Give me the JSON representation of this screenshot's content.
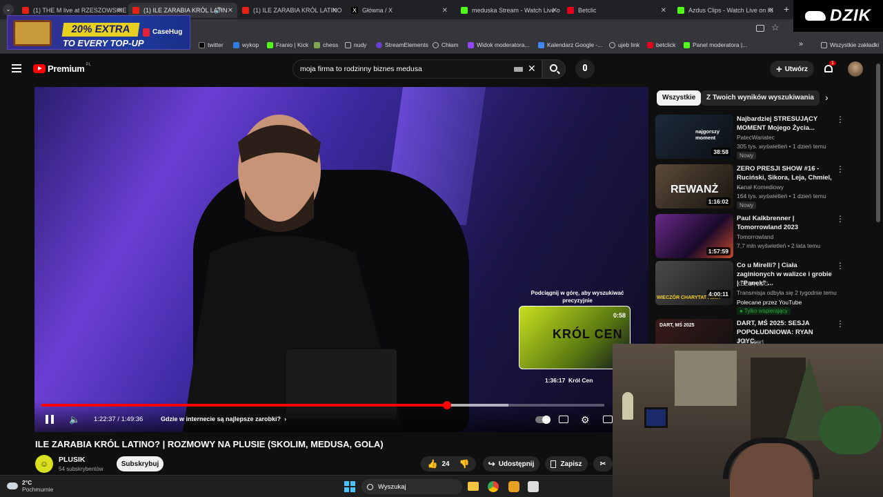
{
  "browser": {
    "tabs": [
      {
        "label": "(1) THE M live at RZESZOWSKIE",
        "color": "#e62117"
      },
      {
        "label": "(1) ILE ZARABIA KRÓL LATIN",
        "color": "#e62117"
      },
      {
        "label": "(1) ILE ZARABIA KRÓL LATINO",
        "color": "#e62117"
      },
      {
        "label": "Główna / X",
        "color": "#ffffff"
      },
      {
        "label": "meduska Stream - Watch Live o",
        "color": "#53fc18"
      },
      {
        "label": "Betclic",
        "color": "#e2001a"
      },
      {
        "label": "Azdus Clips - Watch Live on Ki",
        "color": "#53fc18"
      }
    ],
    "new_tab": "+",
    "bookmarks": [
      {
        "label": "twitter",
        "color": "#ffffff"
      },
      {
        "label": "wykop",
        "color": "#2f7de1"
      },
      {
        "label": "Franio | Kick",
        "color": "#53fc18"
      },
      {
        "label": "chess",
        "color": "#7fa650"
      },
      {
        "label": "nudy",
        "color": "#bbbbbb"
      },
      {
        "label": "StreamElements",
        "color": "#6b3fd4"
      },
      {
        "label": "Chłam",
        "color": "#bbbbbb"
      },
      {
        "label": "Widok moderatora...",
        "color": "#9146ff"
      },
      {
        "label": "Kalendarz Google -...",
        "color": "#4285f4"
      },
      {
        "label": "ujeb link",
        "color": "#bbbbbb"
      },
      {
        "label": "betclick",
        "color": "#e2001a"
      },
      {
        "label": "Panel moderatora |...",
        "color": "#53fc18"
      }
    ],
    "bookmarks_more": "»",
    "all_bookmarks": "Wszystkie zakładki"
  },
  "ad": {
    "line1": "20% EXTRA",
    "line2": "TO EVERY TOP-UP",
    "brand": "CaseHug"
  },
  "overlay_logo": "DZIK",
  "youtube": {
    "logo": "Premium",
    "logo_region": "PL",
    "search_value": "moja firma to rodzinny biznes medusa",
    "create_label": "Utwórz",
    "notifications_count": "1"
  },
  "player": {
    "time": "1:22:37 / 1:49:36",
    "chapter": "Gdzie w internecie są najlepsze zarobki?",
    "progress": 0.72,
    "hover_fraction": 0.83,
    "preview_hint": "Podciągnij w górę, aby wyszukiwać precyzyjnie",
    "preview_time": "1:36:17",
    "preview_chapter": "Król Cen",
    "preview_thumb_text": "KRÓL CEN",
    "preview_timer": "0:58"
  },
  "video": {
    "title": "ILE ZARABIA KRÓL LATINO? | ROZMOWY NA PLUSIE (SKOLIM, MEDUSA, GOLA)",
    "channel": "PLUSIK",
    "subscribers": "54 subskrybentów",
    "subscribe_label": "Subskrybuj",
    "likes": "24",
    "share_label": "Udostępnij",
    "save_label": "Zapisz"
  },
  "sidebar": {
    "chips": [
      "Wszystkie",
      "Z Twoich wyników wyszukiwania"
    ],
    "videos": [
      {
        "title": "Najbardziej STRESUJĄCY MOMENT Mojego Życia...",
        "channel": "PatecWariatec",
        "meta": "305 tys. wyświetleń • 1 dzień temu",
        "badge": "Nowy",
        "duration": "38:58",
        "thumb_text": "najgorszy moment",
        "thumb_color": "#1c2a3a"
      },
      {
        "title": "ZERO PRESJI SHOW #16 - Ruciński, Sikora, Leja, Chmiel, ...",
        "channel": "Kanał Komediowy",
        "meta": "164 tys. wyświetleń • 1 dzień temu",
        "badge": "Nowy",
        "duration": "1:16:02",
        "thumb_text": "REWANŻ",
        "thumb_color": "#3a2a1a"
      },
      {
        "title": "Paul Kalkbrenner | Tomorrowland 2023",
        "channel": "Tomorrowland",
        "meta": "7,7 mln wyświetleń • 2 lata temu",
        "badge": "",
        "duration": "1:57:59",
        "thumb_text": "",
        "thumb_color": "#3a1a4a"
      },
      {
        "title": "Co u Mirelli? | Ciała zaginionych w walizce i grobie | \"Panek\" ...",
        "channel": "KEZUVLOG",
        "meta": "Transmisja odbyła się 2 tygodnie temu",
        "badge": "Polecane przez YouTube",
        "extra": "Tylko wspierający",
        "duration": "4:00:11",
        "thumb_text": "WIECZÓR CHARYTATYWNY",
        "thumb_color": "#2a2a2a"
      },
      {
        "title": "DART, MŚ 2025: SESJA POPOŁUDNIOWA: RYAN JOYC...",
        "channel": "TVP Sport",
        "meta": "",
        "badge": "",
        "duration": "",
        "thumb_text": "DART, MŚ 2025",
        "thumb_color": "#2a1a1a"
      }
    ]
  },
  "taskbar": {
    "weather_temp": "2°C",
    "weather_desc": "Pochmurnie",
    "search_label": "Wyszukaj"
  }
}
